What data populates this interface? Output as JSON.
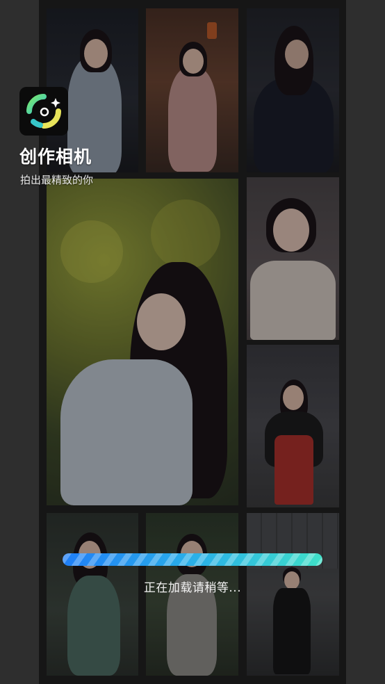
{
  "app": {
    "name": "创作相机",
    "tagline": "拍出最精致的你",
    "logo_icon": "camera-lens-ring-icon",
    "accent_colors": [
      "#7be86b",
      "#37c6c9",
      "#e8e45a"
    ]
  },
  "loading": {
    "text": "正在加载请稍等...",
    "progress_fraction": 1.0,
    "bar_colors": [
      "#1f7ef7",
      "#2bb4e6",
      "#3fe0c8"
    ]
  },
  "gallery": {
    "photos": [
      "hanfu-white-dress-photo",
      "hanfu-pink-dress-photo",
      "dark-costume-photo",
      "flower-hanfu-portrait-photo",
      "white-gown-portrait-photo",
      "red-dress-street-photo",
      "green-qipao-photo",
      "garden-dress-photo",
      "black-suit-photo"
    ]
  }
}
